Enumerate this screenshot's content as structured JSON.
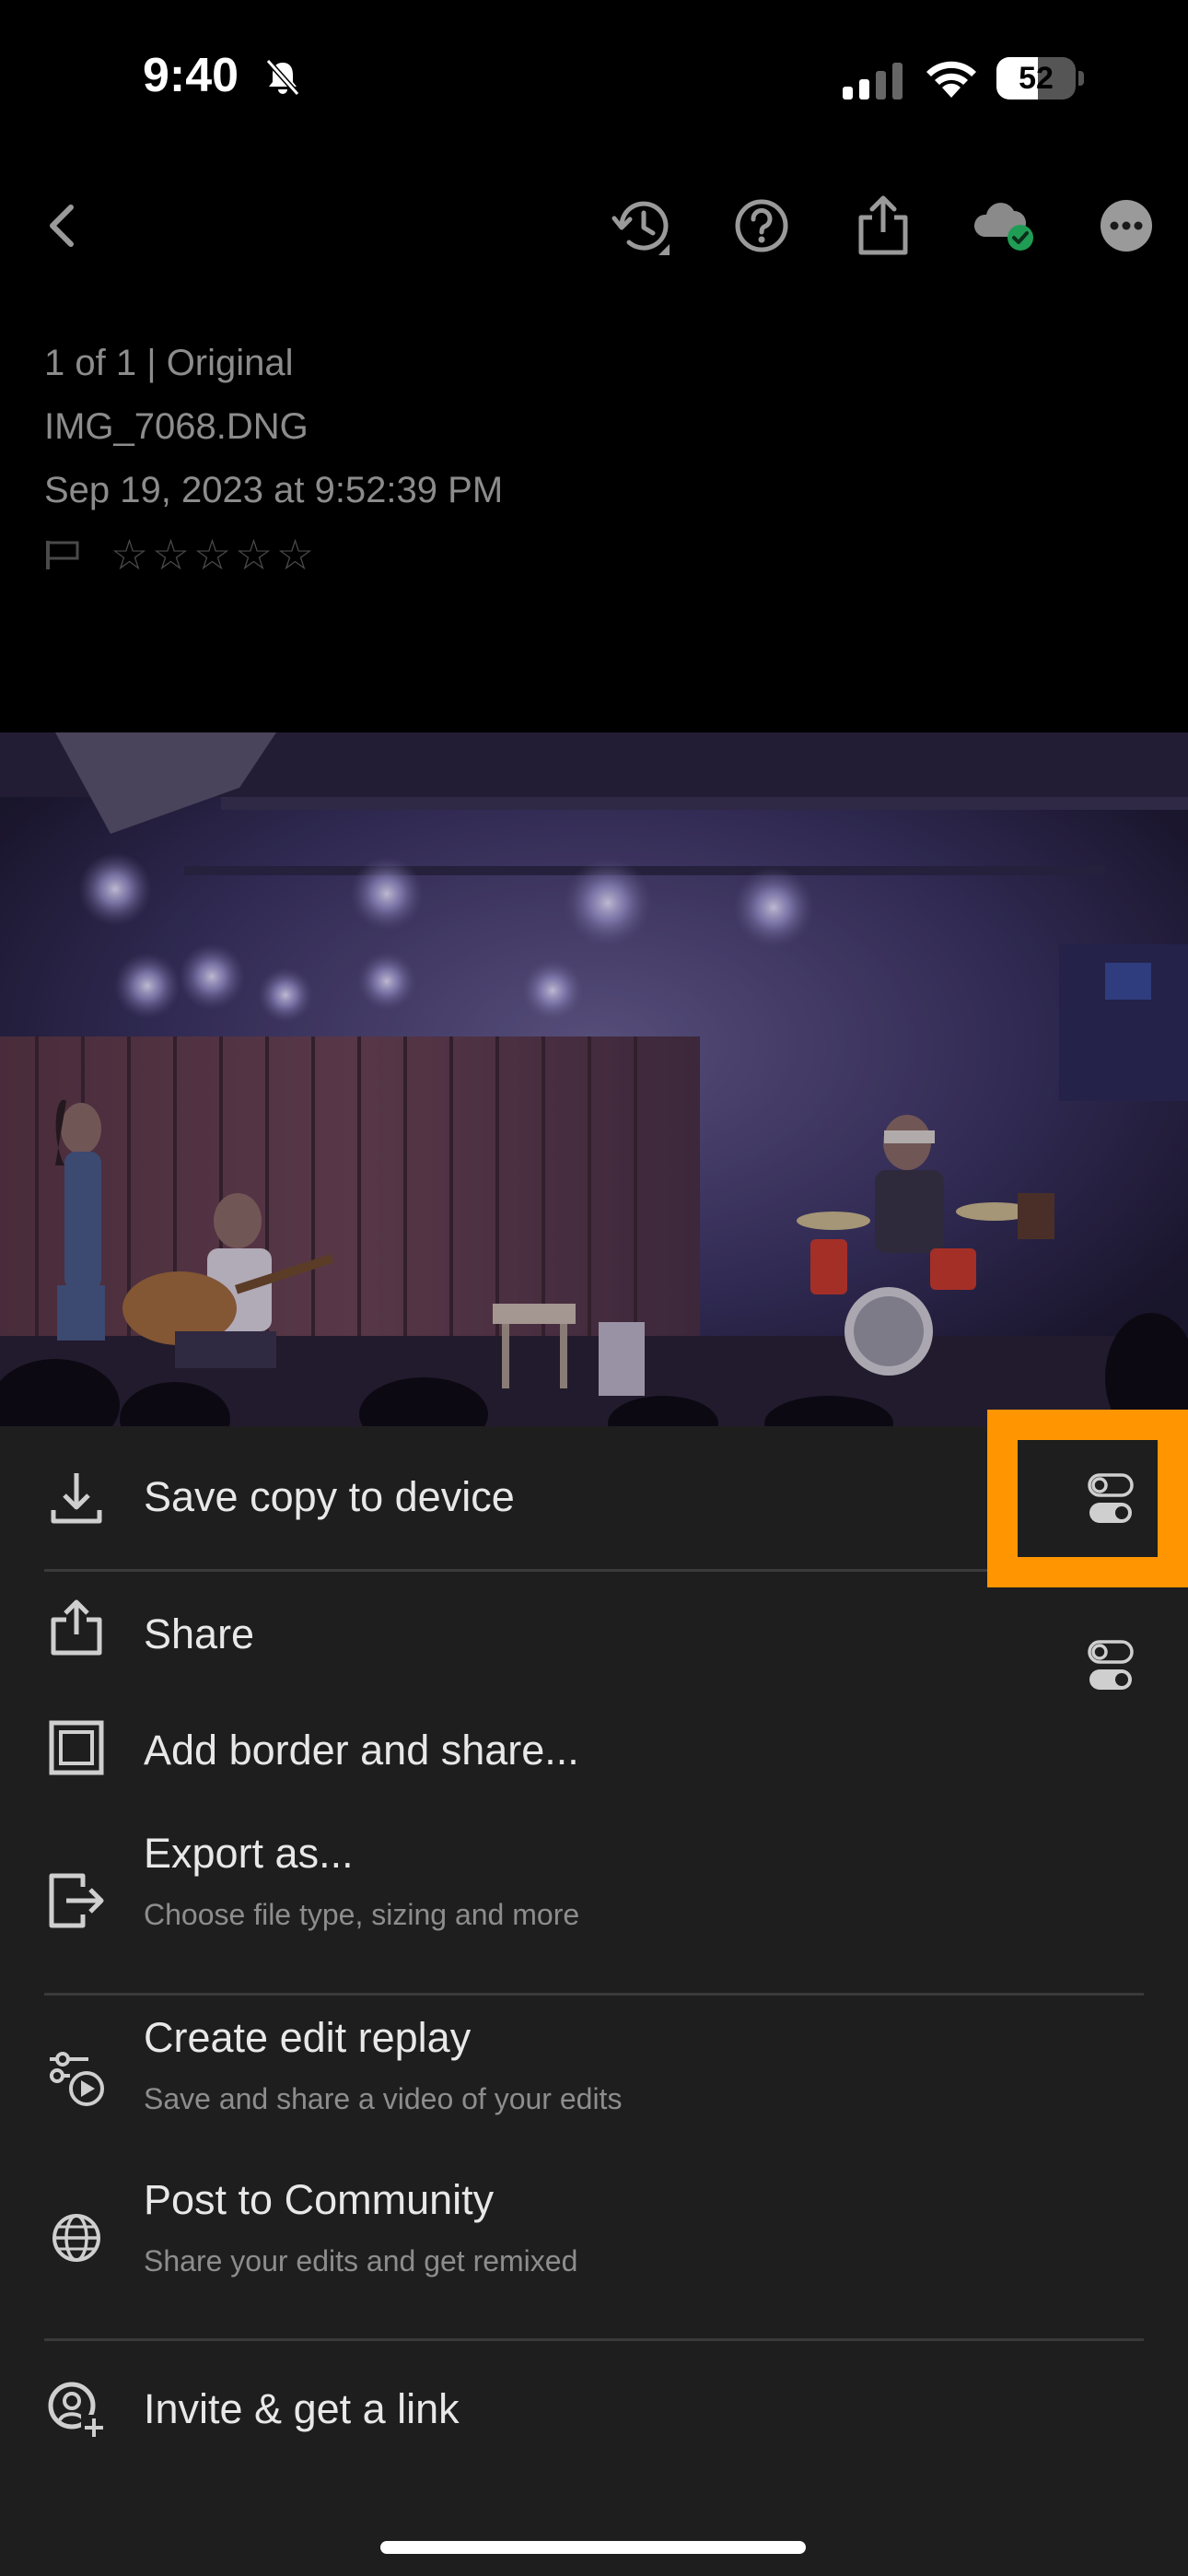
{
  "status_bar": {
    "time": "9:40",
    "battery_level": "52",
    "battery_fraction": 0.52
  },
  "toolbar": {
    "buttons": [
      "back-icon",
      "history-icon",
      "help-icon",
      "share-icon",
      "cloud-synced-icon",
      "more-icon"
    ]
  },
  "meta": {
    "position": "1 of 1 | Original",
    "filename": "IMG_7068.DNG",
    "date": "Sep 19, 2023 at 9:52:39 PM",
    "rating": 0,
    "max_rating": 5
  },
  "share_menu": {
    "items": [
      {
        "title": "Save copy to device",
        "icon": "download-icon",
        "has_settings": true
      },
      {
        "title": "Share",
        "icon": "share-icon",
        "has_settings": true
      },
      {
        "title": "Add border and share...",
        "icon": "border-icon"
      },
      {
        "title": "Export as...",
        "subtitle": "Choose file type, sizing and more",
        "icon": "export-icon"
      },
      {
        "title": "Create edit replay",
        "subtitle": "Save and share a video of your edits",
        "icon": "edit-replay-icon"
      },
      {
        "title": "Post to Community",
        "subtitle": "Share your edits and get remixed",
        "icon": "globe-icon"
      },
      {
        "title": "Invite & get a link",
        "icon": "invite-icon"
      }
    ]
  },
  "colors": {
    "highlight": "#FF9500",
    "sheet_background": "#1e1e1e",
    "sync_badge": "#1f9d55"
  }
}
